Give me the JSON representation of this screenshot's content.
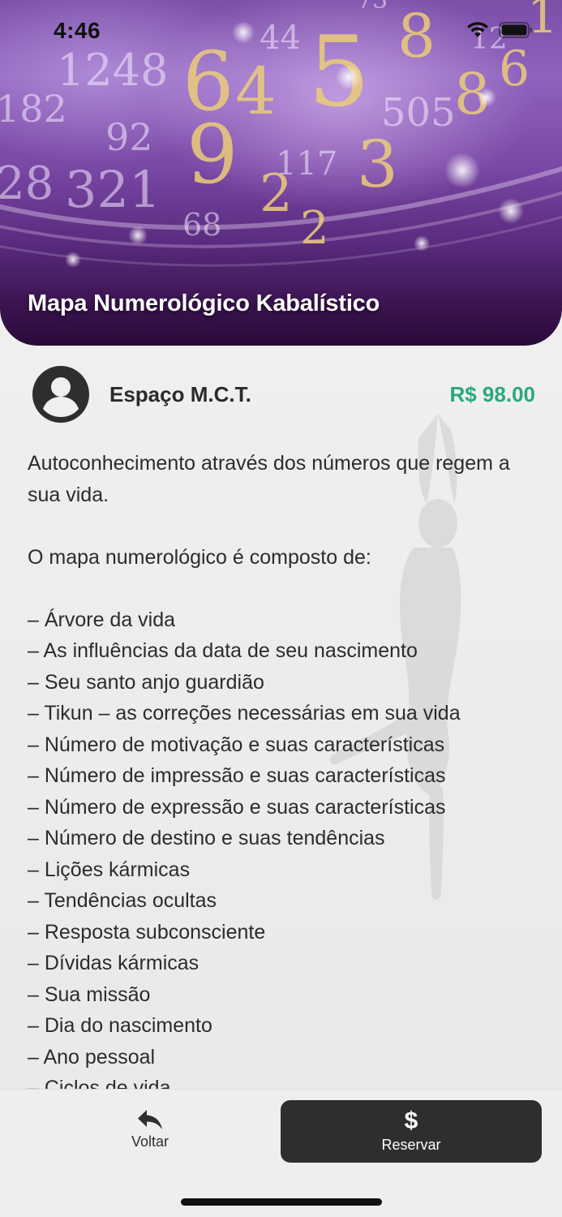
{
  "status_bar": {
    "time": "4:46",
    "icons": [
      "wifi-icon",
      "battery-icon"
    ]
  },
  "hero": {
    "title": "Mapa Numerológico Kabalístico",
    "image_description_icon": "numerology-banner-image"
  },
  "provider": {
    "name": "Espaço M.C.T.",
    "avatar_icon": "user-avatar-icon",
    "price": "R$ 98.00",
    "price_color": "#2aa97a"
  },
  "description": {
    "intro": "Autoconhecimento através dos números que regem a sua vida.",
    "list_heading": "O mapa numerológico é composto de:",
    "items": [
      "– Árvore da vida",
      "– As influências da data de seu nascimento",
      "– Seu santo anjo guardião",
      "– Tikun – as correções necessárias em sua vida",
      "– Número de motivação e suas características",
      "– Número de impressão e suas características",
      "– Número de expressão e suas características",
      "– Número de destino e suas tendências",
      "– Lições kármicas",
      "– Tendências ocultas",
      "– Resposta subconsciente",
      "– Dívidas kármicas",
      "– Sua missão",
      "– Dia do nascimento",
      "– Ano pessoal",
      "– Ciclos de vida"
    ]
  },
  "actions": {
    "back_label": "Voltar",
    "back_icon": "reply-arrow-icon",
    "reserve_label": "Reservar",
    "reserve_icon": "dollar-icon",
    "reserve_icon_glyph": "$"
  },
  "colors": {
    "accent_price": "#2aa97a",
    "primary_button": "#2e2e2e",
    "hero_purple": "#7a48a6"
  }
}
